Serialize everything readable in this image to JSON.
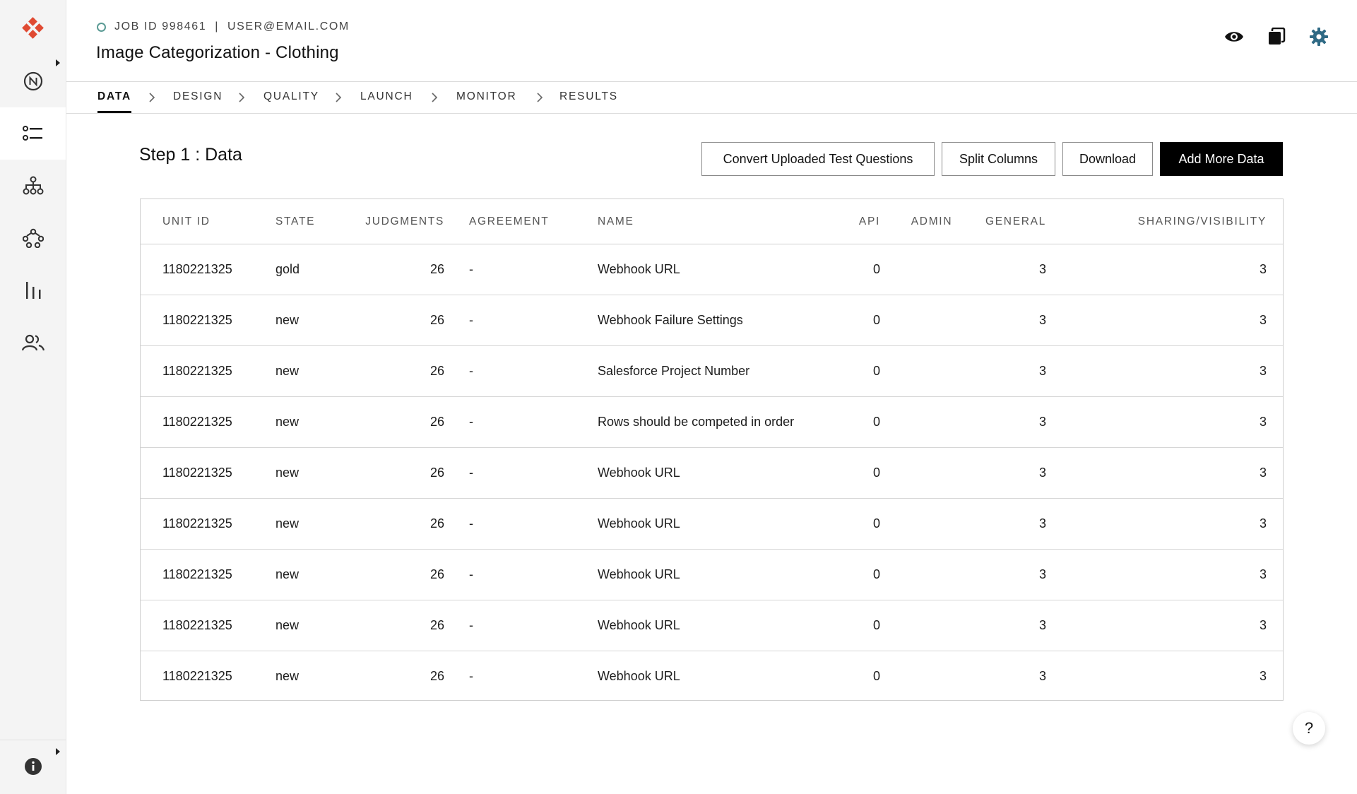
{
  "header": {
    "job_id": "JOB ID 998461",
    "separator": "|",
    "user_email": "USER@EMAIL.COM",
    "title": "Image Categorization - Clothing"
  },
  "tabs": [
    {
      "label": "DATA",
      "active": true
    },
    {
      "label": "DESIGN",
      "active": false
    },
    {
      "label": "QUALITY",
      "active": false
    },
    {
      "label": "LAUNCH",
      "active": false
    },
    {
      "label": "MONITOR",
      "active": false
    },
    {
      "label": "RESULTS",
      "active": false
    }
  ],
  "main": {
    "step_title": "Step 1 : Data",
    "buttons": {
      "convert": "Convert Uploaded Test Questions",
      "split": "Split Columns",
      "download": "Download",
      "add": "Add More Data"
    }
  },
  "table": {
    "columns": [
      "UNIT ID",
      "STATE",
      "JUDGMENTS",
      "AGREEMENT",
      "NAME",
      "API",
      "ADMIN",
      "GENERAL",
      "SHARING/VISIBILITY"
    ],
    "rows": [
      {
        "unit_id": "1180221325",
        "state": "gold",
        "judgments": "26",
        "agreement": "-",
        "name": "Webhook URL",
        "api": "0",
        "admin": "",
        "general": "3",
        "sharing": "3"
      },
      {
        "unit_id": "1180221325",
        "state": "new",
        "judgments": "26",
        "agreement": "-",
        "name": "Webhook Failure Settings",
        "api": "0",
        "admin": "",
        "general": "3",
        "sharing": "3"
      },
      {
        "unit_id": "1180221325",
        "state": "new",
        "judgments": "26",
        "agreement": "-",
        "name": "Salesforce Project Number",
        "api": "0",
        "admin": "",
        "general": "3",
        "sharing": "3"
      },
      {
        "unit_id": "1180221325",
        "state": "new",
        "judgments": "26",
        "agreement": "-",
        "name": "Rows should be competed in order",
        "api": "0",
        "admin": "",
        "general": "3",
        "sharing": "3"
      },
      {
        "unit_id": "1180221325",
        "state": "new",
        "judgments": "26",
        "agreement": "-",
        "name": "Webhook URL",
        "api": "0",
        "admin": "",
        "general": "3",
        "sharing": "3"
      },
      {
        "unit_id": "1180221325",
        "state": "new",
        "judgments": "26",
        "agreement": "-",
        "name": "Webhook URL",
        "api": "0",
        "admin": "",
        "general": "3",
        "sharing": "3"
      },
      {
        "unit_id": "1180221325",
        "state": "new",
        "judgments": "26",
        "agreement": "-",
        "name": "Webhook URL",
        "api": "0",
        "admin": "",
        "general": "3",
        "sharing": "3"
      },
      {
        "unit_id": "1180221325",
        "state": "new",
        "judgments": "26",
        "agreement": "-",
        "name": "Webhook URL",
        "api": "0",
        "admin": "",
        "general": "3",
        "sharing": "3"
      },
      {
        "unit_id": "1180221325",
        "state": "new",
        "judgments": "26",
        "agreement": "-",
        "name": "Webhook URL",
        "api": "0",
        "admin": "",
        "general": "3",
        "sharing": "3"
      }
    ]
  },
  "help": {
    "label": "?"
  },
  "icons": {
    "logo": "logo-icon",
    "sidebar": [
      "notification-icon",
      "list-icon",
      "hierarchy-icon",
      "workflow-icon",
      "chart-icon",
      "team-icon",
      "info-icon"
    ],
    "header": [
      "preview-eye-icon",
      "copy-icon",
      "settings-gear-icon"
    ]
  },
  "colors": {
    "accent_red": "#e04a32",
    "status_teal": "#5b9b95",
    "gear_blue": "#2f6a85",
    "primary_button": "#000000"
  }
}
